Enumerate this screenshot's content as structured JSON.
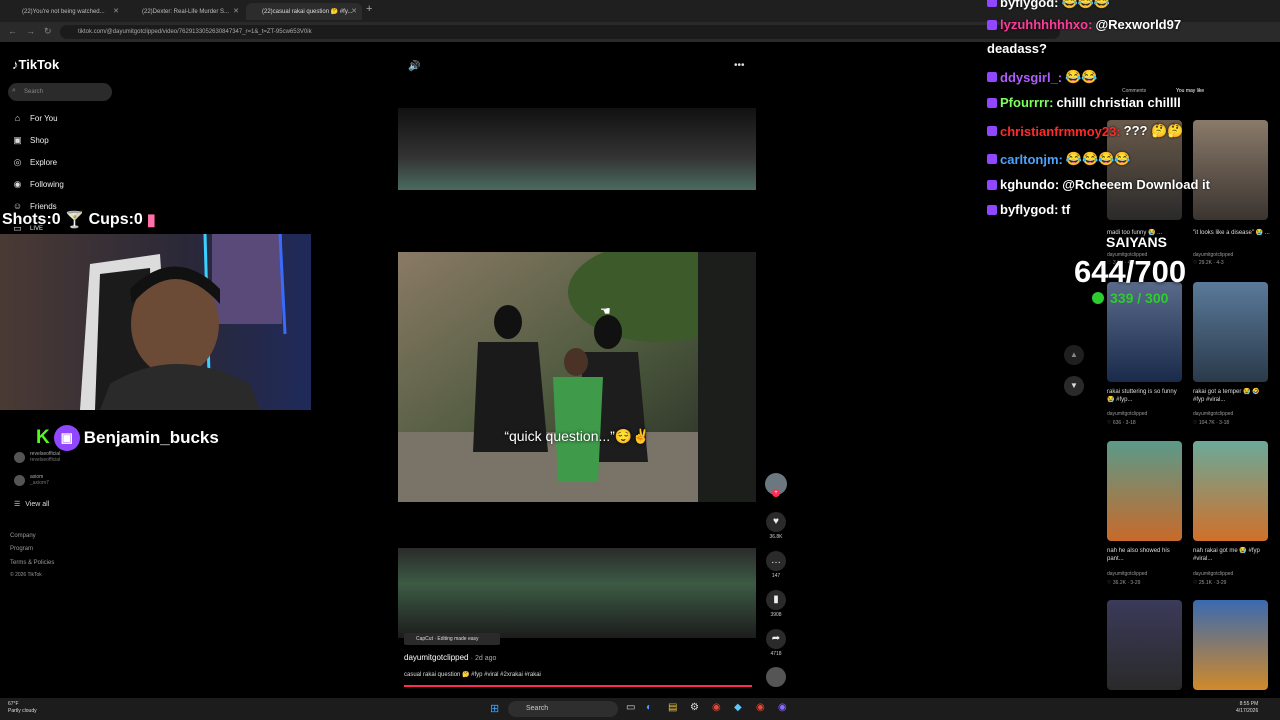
{
  "browser": {
    "tabs": [
      {
        "title": "(22)You're not being watched..."
      },
      {
        "title": "(22)Dexter: Real-Life Murder S..."
      },
      {
        "title": "(22)casual rakai question 🤔 #fy..."
      }
    ],
    "url": "tiktok.com/@dayumitgotclipped/video/7629133052630847347_r=1&_t=ZT-95cw653V0ik"
  },
  "sidebar": {
    "logo": "TikTok",
    "search_placeholder": "Search",
    "items": [
      {
        "label": "For You",
        "icon": "home-icon"
      },
      {
        "label": "Shop",
        "icon": "bag-icon"
      },
      {
        "label": "Explore",
        "icon": "compass-icon"
      },
      {
        "label": "Following",
        "icon": "avatar-icon"
      },
      {
        "label": "Friends",
        "icon": "friends-icon"
      },
      {
        "label": "LIVE",
        "icon": "live-icon"
      }
    ],
    "following": [
      {
        "name": "revelseofficial",
        "sub": "revelseofficial"
      },
      {
        "name": "axiom",
        "sub": "_axiom7"
      }
    ],
    "view_all": "View all",
    "footer": [
      "Company",
      "Program",
      "Terms & Policies",
      "© 2026 TikTok"
    ]
  },
  "overlay": {
    "shots": "Shots:0",
    "cups": "Cups:0",
    "twitch_name": "Benjamin_bucks"
  },
  "video": {
    "caption_overlay": "“quick question...”😌✌️",
    "capcut": "CapCut · Editing made easy",
    "author": "dayumitgotclipped",
    "age": "· 2d ago",
    "description": "casual rakai question 🤔 #fyp #viral #2xrakai #rakai",
    "actions": [
      {
        "icon": "heart-icon",
        "count": "36.8K"
      },
      {
        "icon": "comment-icon",
        "count": "147"
      },
      {
        "icon": "bookmark-icon",
        "count": "3908"
      },
      {
        "icon": "share-icon",
        "count": "4718"
      }
    ]
  },
  "chat": [
    {
      "user": "byflygod:",
      "color": "#ffffff",
      "msg": "😂😂😂"
    },
    {
      "user": "lyzuhhhhhhxo:",
      "color": "#ff3b9a",
      "msg": "@Rexworld97"
    },
    {
      "user": "",
      "color": "#ffffff",
      "msg": "deadass?"
    },
    {
      "user": "ddysgirl_:",
      "color": "#b05cff",
      "msg": "😂😂"
    },
    {
      "user": "Pfourrrr:",
      "color": "#7dff5c",
      "msg": "chilll christian chillll"
    },
    {
      "user": "christianfrmmoy23:",
      "color": "#ff2a2a",
      "msg": "??? 🤔🤔"
    },
    {
      "user": "carltonjm:",
      "color": "#4aa3ff",
      "msg": "😂😂😂😂"
    },
    {
      "user": "kghundo:",
      "color": "#ffffff",
      "msg": "@Rcheeem Download it"
    },
    {
      "user": "byflygod:",
      "color": "#ffffff",
      "msg": "tf"
    }
  ],
  "goals": {
    "label": "SAIYANS",
    "count": "644/700",
    "sub": "339 / 300"
  },
  "right_panel": {
    "tabs": [
      "Comments",
      "You may like"
    ],
    "videos": [
      {
        "title": "madi too funny 😭 ...",
        "user": "dayumitgotclipped",
        "meta": "♡ 3.3K · 4-3"
      },
      {
        "title": "\"it looks like a disease\" 😭 ...",
        "user": "dayumitgotclipped",
        "meta": "♡ 29.2K · 4-3"
      },
      {
        "title": "rakai stuttering is so funny 😭 #fyp...",
        "user": "dayumitgotclipped",
        "meta": "♡ 636 · 3-18"
      },
      {
        "title": "rakai got a temper 😭 🤣 #fyp #viral...",
        "user": "dayumitgotclipped",
        "meta": "♡ 104.7K · 3-18"
      },
      {
        "title": "nah he also showed his pant...",
        "user": "dayumitgotclipped",
        "meta": "♡ 36.2K · 3-29"
      },
      {
        "title": "nah rakai got me 😭 #fyp #viral...",
        "user": "dayumitgotclipped",
        "meta": "♡ 25.1K · 3-29"
      }
    ]
  },
  "taskbar": {
    "weather_temp": "67°F",
    "weather_desc": "Partly cloudy",
    "search": "Search",
    "time": "8:55 PM",
    "date": "4/17/2026"
  }
}
